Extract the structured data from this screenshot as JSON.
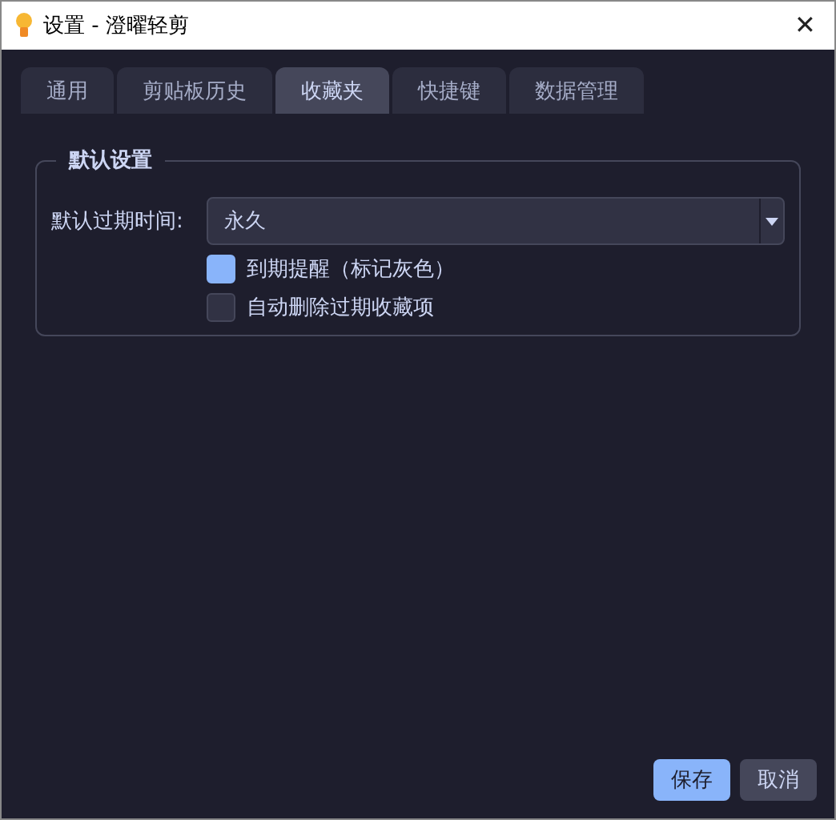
{
  "window": {
    "title": "设置 - 澄曜轻剪",
    "close": "✕"
  },
  "tabs": [
    {
      "label": "通用",
      "selected": false
    },
    {
      "label": "剪贴板历史",
      "selected": false
    },
    {
      "label": "收藏夹",
      "selected": true
    },
    {
      "label": "快捷键",
      "selected": false
    },
    {
      "label": "数据管理",
      "selected": false
    }
  ],
  "group": {
    "title": "默认设置",
    "expiry": {
      "label": "默认过期时间:",
      "value": "永久"
    },
    "checkboxes": [
      {
        "label": "到期提醒（标记灰色）",
        "checked": true
      },
      {
        "label": "自动删除过期收藏项",
        "checked": false
      }
    ]
  },
  "buttons": [
    {
      "label": "保存",
      "kind": "primary"
    },
    {
      "label": "取消",
      "kind": "secondary"
    }
  ]
}
